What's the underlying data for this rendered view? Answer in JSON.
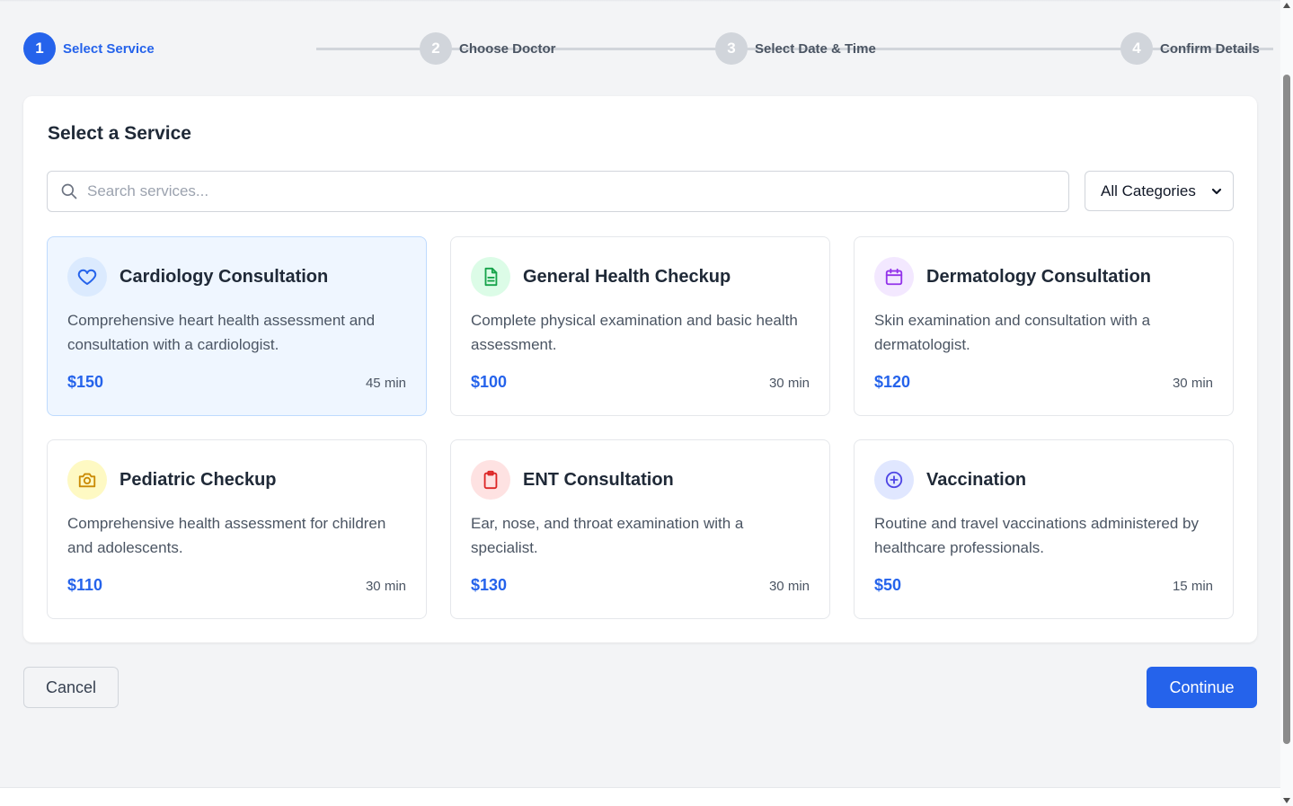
{
  "stepper": {
    "steps": [
      {
        "number": "1",
        "label": "Select Service",
        "active": true
      },
      {
        "number": "2",
        "label": "Choose Doctor",
        "active": false
      },
      {
        "number": "3",
        "label": "Select Date & Time",
        "active": false
      },
      {
        "number": "4",
        "label": "Confirm Details",
        "active": false
      }
    ]
  },
  "panel": {
    "title": "Select a Service",
    "search": {
      "placeholder": "Search services...",
      "value": "",
      "icon": "search-icon"
    },
    "category_select": {
      "value": "All Categories",
      "icon": "chevron-down-icon"
    }
  },
  "services": [
    {
      "name": "Cardiology Consultation",
      "description": "Comprehensive heart health assessment and consultation with a cardiologist.",
      "price": "$150",
      "duration": "45 min",
      "icon": "heart-icon",
      "icon_color": "#2563eb",
      "icon_bg": "#dbeafe",
      "selected": true
    },
    {
      "name": "General Health Checkup",
      "description": "Complete physical examination and basic health assessment.",
      "price": "$100",
      "duration": "30 min",
      "icon": "document-icon",
      "icon_color": "#16a34a",
      "icon_bg": "#dcfce7",
      "selected": false
    },
    {
      "name": "Dermatology Consultation",
      "description": "Skin examination and consultation with a dermatologist.",
      "price": "$120",
      "duration": "30 min",
      "icon": "calendar-icon",
      "icon_color": "#9333ea",
      "icon_bg": "#f3e8ff",
      "selected": false
    },
    {
      "name": "Pediatric Checkup",
      "description": "Comprehensive health assessment for children and adolescents.",
      "price": "$110",
      "duration": "30 min",
      "icon": "camera-icon",
      "icon_color": "#ca8a04",
      "icon_bg": "#fef9c3",
      "selected": false
    },
    {
      "name": "ENT Consultation",
      "description": "Ear, nose, and throat examination with a specialist.",
      "price": "$130",
      "duration": "30 min",
      "icon": "clipboard-icon",
      "icon_color": "#dc2626",
      "icon_bg": "#fee2e2",
      "selected": false
    },
    {
      "name": "Vaccination",
      "description": "Routine and travel vaccinations administered by healthcare professionals.",
      "price": "$50",
      "duration": "15 min",
      "icon": "plus-circle-icon",
      "icon_color": "#4f46e5",
      "icon_bg": "#e0e7ff",
      "selected": false
    }
  ],
  "actions": {
    "cancel_label": "Cancel",
    "continue_label": "Continue"
  },
  "colors": {
    "accent": "#2563eb",
    "inactive_step": "#d1d5db",
    "page_bg": "#f3f4f6"
  }
}
